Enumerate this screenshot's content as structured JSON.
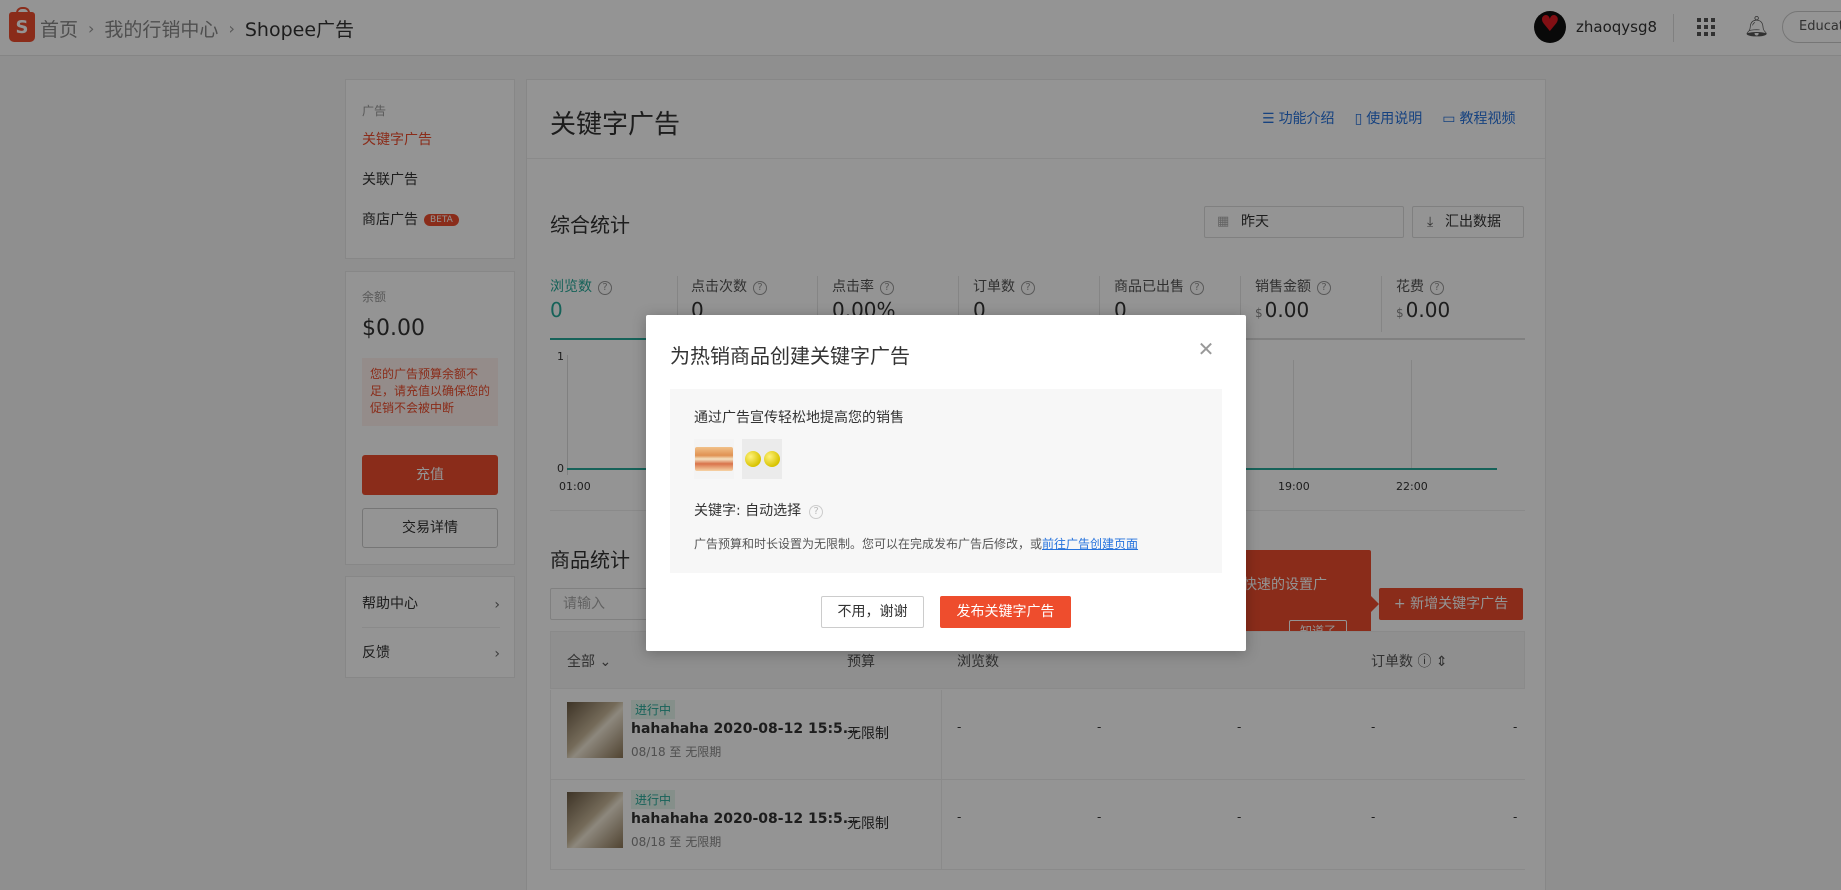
{
  "header": {
    "breadcrumb": [
      "首页",
      "我的行销中心",
      "Shopee广告"
    ],
    "user_name": "zhaoqysg8",
    "education_label": "Education"
  },
  "sidebar": {
    "section_label": "广告",
    "items": [
      {
        "label": "关键字广告",
        "active": true
      },
      {
        "label": "关联广告",
        "active": false
      },
      {
        "label": "商店广告",
        "active": false,
        "badge": "BETA"
      }
    ],
    "balance_label": "余额",
    "balance_value": "$0.00",
    "warning": "您的广告预算余额不足，请充值以确保您的促销不会被中断",
    "recharge_label": "充值",
    "transaction_label": "交易详情",
    "help_label": "帮助中心",
    "feedback_label": "反馈"
  },
  "main": {
    "title": "关键字广告",
    "links": [
      "功能介绍",
      "使用说明",
      "教程视频"
    ],
    "stats_title": "综合统计",
    "date_value": "昨天",
    "export_label": "汇出数据",
    "metrics": [
      {
        "name": "浏览数",
        "value": "0",
        "currency": ""
      },
      {
        "name": "点击次数",
        "value": "0",
        "currency": ""
      },
      {
        "name": "点击率",
        "value": "0.00%",
        "currency": ""
      },
      {
        "name": "订单数",
        "value": "0",
        "currency": ""
      },
      {
        "name": "商品已出售",
        "value": "0",
        "currency": ""
      },
      {
        "name": "销售金额",
        "value": "0.00",
        "currency": "$"
      },
      {
        "name": "花费",
        "value": "0.00",
        "currency": "$"
      }
    ],
    "chart": {
      "y_top": "1",
      "y_bottom": "0",
      "x_labels": [
        "01:00",
        "19:00",
        "22:00"
      ]
    },
    "product_stats_title": "商品统计",
    "search_placeholder": "请输入",
    "add_button_label": "+ 新增关键字广告",
    "tooltip_text": "快速的设置广",
    "tooltip_ok": "知道了",
    "table_headers": [
      "全部",
      "预算",
      "浏览数",
      "订单数"
    ],
    "rows": [
      {
        "status": "进行中",
        "name": "hahahaha 2020-08-12 15:5...",
        "period": "08/18 至 无限期",
        "budget": "无限制"
      },
      {
        "status": "进行中",
        "name": "hahahaha 2020-08-12 15:5...",
        "period": "08/18 至 无限期",
        "budget": "无限制"
      }
    ],
    "dash": "-"
  },
  "modal": {
    "title": "为热销商品创建关键字广告",
    "description": "通过广告宣传轻松地提高您的销售",
    "keyword_label": "关键字: 自动选择",
    "note": "广告预算和时长设置为无限制。您可以在完成发布广告后修改，或",
    "note_link": "前往广告创建页面",
    "cancel_label": "不用，谢谢",
    "publish_label": "发布关键字广告"
  },
  "colors": {
    "brand": "#ee4d2d",
    "teal": "#26aa99",
    "link": "#2673dd"
  }
}
